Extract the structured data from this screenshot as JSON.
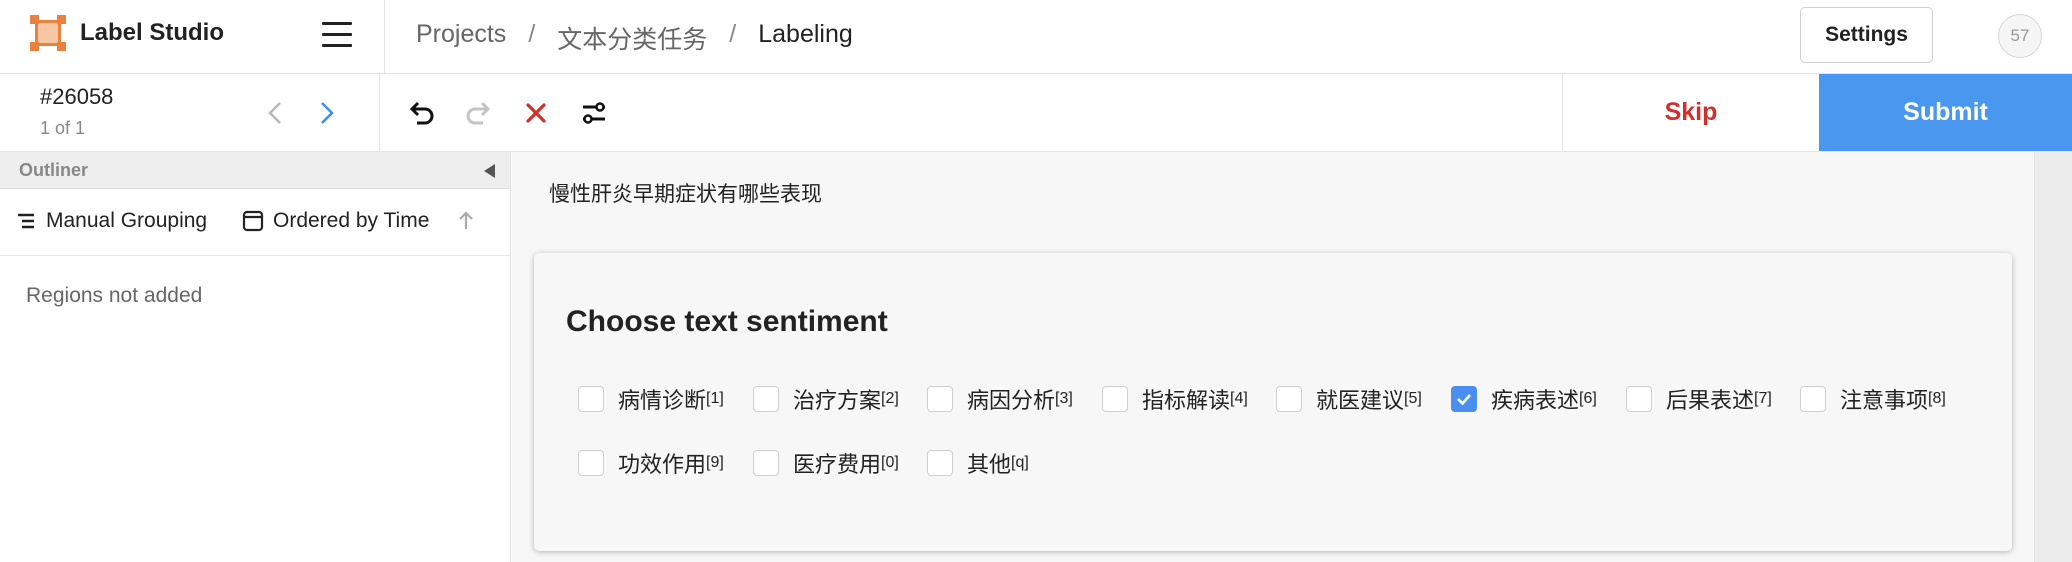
{
  "header": {
    "app_title": "Label Studio",
    "breadcrumbs": [
      "Projects",
      "文本分类任务",
      "Labeling"
    ],
    "separator": "/",
    "settings_label": "Settings",
    "avatar_text": "57"
  },
  "toolbar": {
    "task_id": "#26058",
    "task_count": "1 of 1",
    "skip_label": "Skip",
    "submit_label": "Submit"
  },
  "outliner": {
    "title": "Outliner",
    "grouping_label": "Manual Grouping",
    "ordering_label": "Ordered by Time",
    "empty_text": "Regions not added"
  },
  "main": {
    "question": "慢性肝炎早期症状有哪些表现",
    "card_title": "Choose text sentiment",
    "options": [
      {
        "label": "病情诊断",
        "hotkey": "[1]",
        "checked": false
      },
      {
        "label": "治疗方案",
        "hotkey": "[2]",
        "checked": false
      },
      {
        "label": "病因分析",
        "hotkey": "[3]",
        "checked": false
      },
      {
        "label": "指标解读",
        "hotkey": "[4]",
        "checked": false
      },
      {
        "label": "就医建议",
        "hotkey": "[5]",
        "checked": false
      },
      {
        "label": "疾病表述",
        "hotkey": "[6]",
        "checked": true
      },
      {
        "label": "后果表述",
        "hotkey": "[7]",
        "checked": false
      },
      {
        "label": "注意事项",
        "hotkey": "[8]",
        "checked": false
      },
      {
        "label": "功效作用",
        "hotkey": "[9]",
        "checked": false
      },
      {
        "label": "医疗费用",
        "hotkey": "[0]",
        "checked": false
      },
      {
        "label": "其他",
        "hotkey": "[q]",
        "checked": false
      }
    ]
  },
  "colors": {
    "accent": "#4a97f0",
    "skip": "#d0302b",
    "logo": "#e9823e"
  }
}
